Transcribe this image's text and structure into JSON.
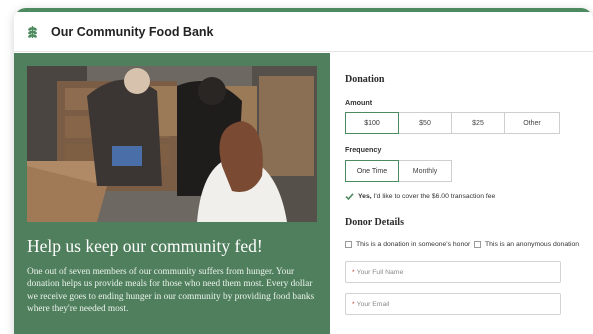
{
  "header": {
    "org_name": "Our Community Food Bank",
    "logo_icon": "wheat-leaf-icon"
  },
  "hero": {
    "headline": "Help us keep our community fed!",
    "blurb": "One out of seven members of our community suffers from hunger. Your donation helps us provide meals for those who need them most. Every dollar we receive goes to ending hunger in our community by providing food banks where they're needed most."
  },
  "donation": {
    "title": "Donation",
    "amount_label": "Amount",
    "amounts": [
      "$100",
      "$50",
      "$25",
      "Other"
    ],
    "selected_amount": "$100",
    "frequency_label": "Frequency",
    "frequencies": [
      "One Time",
      "Monthly"
    ],
    "selected_frequency": "One Time",
    "fee_yes": "Yes,",
    "fee_text": " I'd like to cover the $6.00 transaction fee",
    "fee_checked": true
  },
  "donor": {
    "title": "Donor Details",
    "honor_label": "This is a donation in someone's honor",
    "anonymous_label": "This is an anonymous donation",
    "name_placeholder": "Your Full Name",
    "email_placeholder": "Your Email",
    "required_mark": "*"
  },
  "colors": {
    "accent": "#4e8a5f",
    "panel": "#4f7f5c"
  }
}
